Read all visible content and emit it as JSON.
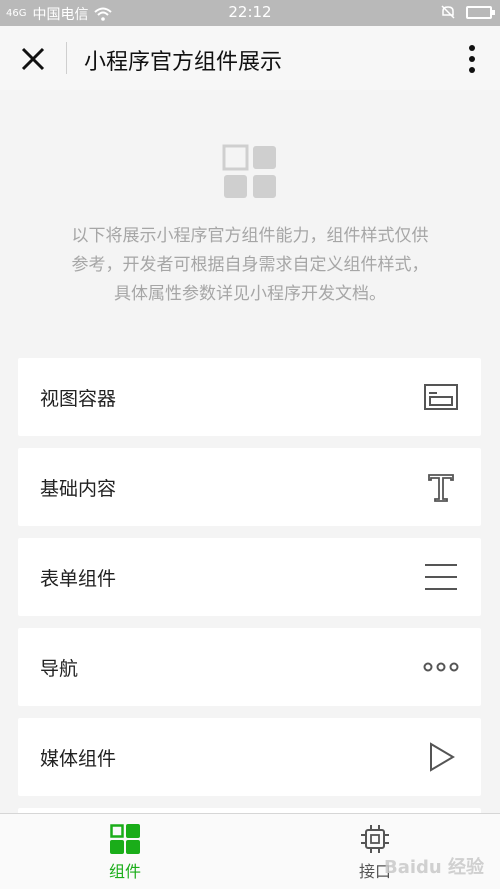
{
  "status_bar": {
    "signal_text": "46G",
    "carrier": "中国电信",
    "time": "22:12",
    "icons": [
      "signal-icon",
      "wifi-icon",
      "mute-icon",
      "battery-icon"
    ]
  },
  "navbar": {
    "title": "小程序官方组件展示",
    "close_icon": "close-icon",
    "more_icon": "more-icon"
  },
  "intro": {
    "icon": "components-grid-icon",
    "line1": "以下将展示小程序官方组件能力，组件样式仅供",
    "line2": "参考，开发者可根据自身需求自定义组件样式，",
    "line3": "具体属性参数详见小程序开发文档。"
  },
  "menu": {
    "items": [
      {
        "label": "视图容器",
        "icon": "view-container-icon"
      },
      {
        "label": "基础内容",
        "icon": "text-icon"
      },
      {
        "label": "表单组件",
        "icon": "form-lines-icon"
      },
      {
        "label": "导航",
        "icon": "dots-icon"
      },
      {
        "label": "媒体组件",
        "icon": "play-icon"
      }
    ]
  },
  "tabbar": {
    "tabs": [
      {
        "label": "组件",
        "icon": "components-tab-icon",
        "active": true
      },
      {
        "label": "接口",
        "icon": "chip-icon",
        "active": false
      }
    ]
  },
  "watermark": "Baidu 经验",
  "colors": {
    "accent": "#1aad19",
    "background": "#f4f4f4",
    "statusbar": "#b9b9b9",
    "intro_text": "#a6a6a6"
  }
}
